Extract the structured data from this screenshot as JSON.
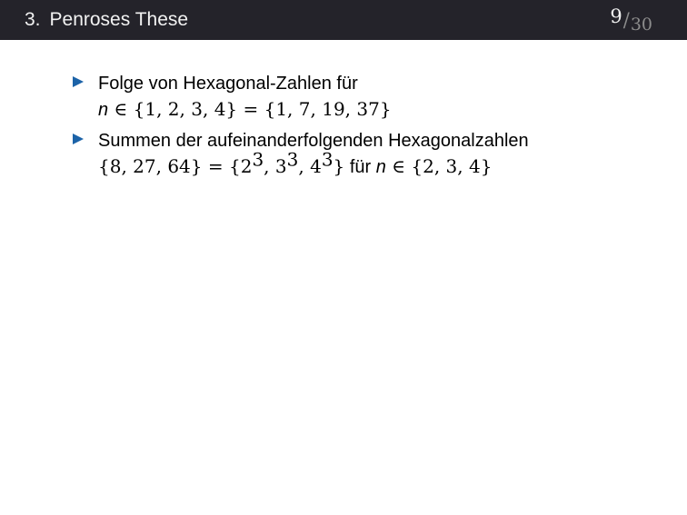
{
  "header": {
    "section_number": "3.",
    "title": "Penroses These",
    "page_current": "9",
    "page_separator": "/",
    "page_total": "30"
  },
  "items": [
    {
      "text_line1": "Folge von Hexagonal-Zahlen für",
      "var": "n",
      "math_line2": " ∈ {1, 2, 3, 4} = {1, 7, 19, 37}"
    },
    {
      "text_line1": "Summen der aufeinanderfolgenden Hexagonalzahlen",
      "math_part1": "{8, 27, 64} = {2",
      "exp1": "3",
      "math_part2": ", 3",
      "exp2": "3",
      "math_part3": ", 4",
      "exp3": "3",
      "math_part4": "}",
      "text_fuer": " für ",
      "var": "n",
      "math_part5": " ∈ {2, 3, 4}"
    }
  ],
  "colors": {
    "header_background": "#24232a",
    "header_text": "#f2f2f2",
    "page_total_text": "#8c8c8c",
    "bullet": "#1c63a8"
  }
}
